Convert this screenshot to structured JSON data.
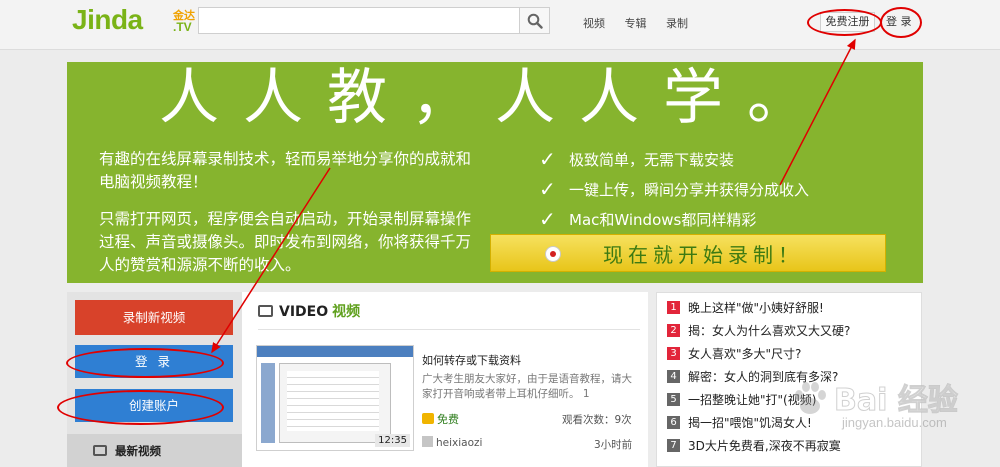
{
  "header": {
    "logo_main": "Jinda",
    "logo_cn": "金达",
    "logo_tv": ".TV",
    "search": {
      "value": "",
      "placeholder": ""
    },
    "nav": [
      "视频",
      "专辑",
      "录制"
    ],
    "register_label": "免费注册",
    "login_label": "登 录"
  },
  "hero": {
    "title": "人人教，人人学。",
    "intro": "有趣的在线屏幕录制技术，轻而易举地分享你的成就和电脑视频教程！",
    "description": "只需打开网页，程序便会自动启动，开始录制屏幕操作过程、声音或摄像头。即时发布到网络，你将获得千万人的赞赏和源源不断的收入。",
    "features": [
      "极致简单，无需下载安装",
      "一键上传，瞬间分享并获得分成收入",
      "Mac和Windows都同样精彩"
    ],
    "record_label": "现在就开始录制！"
  },
  "sidebar": {
    "new_video": "录制新视频",
    "login": "登 录",
    "create_account": "创建账户",
    "latest": "最新视频"
  },
  "video_panel": {
    "heading_en": "VIDEO",
    "heading_cn": "视频",
    "video": {
      "duration": "12:35",
      "title": "如何转存或下载资料",
      "description": "广大考生朋友大家好，由于是语音教程，请大家打开音响或者带上耳机仔细听。 1",
      "price": "免费",
      "views": "观看次数：9次",
      "user": "heixiaozi",
      "ago": "3小时前"
    }
  },
  "hot_list": [
    {
      "num": "1",
      "title": "晚上这样\"做\"小姨好舒服!",
      "color": "#e2253a"
    },
    {
      "num": "2",
      "title": "揭：女人为什么喜欢又大又硬?",
      "color": "#e2253a"
    },
    {
      "num": "3",
      "title": "女人喜欢\"多大\"尺寸?",
      "color": "#e2253a"
    },
    {
      "num": "4",
      "title": "解密：女人的洞到底有多深?",
      "color": "#666666"
    },
    {
      "num": "5",
      "title": "一招整晚让她\"打\"(视频)",
      "color": "#666666"
    },
    {
      "num": "6",
      "title": "揭一招\"喂饱\"饥渴女人!",
      "color": "#666666"
    },
    {
      "num": "7",
      "title": "3D大片免费看,深夜不再寂寞",
      "color": "#666666"
    }
  ],
  "watermark": {
    "text": "Bai 经验",
    "url": "jingyan.baidu.com"
  },
  "colors": {
    "brand_green": "#7ab317",
    "hero_green": "#86b42e",
    "record_button": "#e8c51a",
    "red_button": "#d8422a",
    "blue_button": "#2f7fd3",
    "annotation_red": "#e00000"
  }
}
